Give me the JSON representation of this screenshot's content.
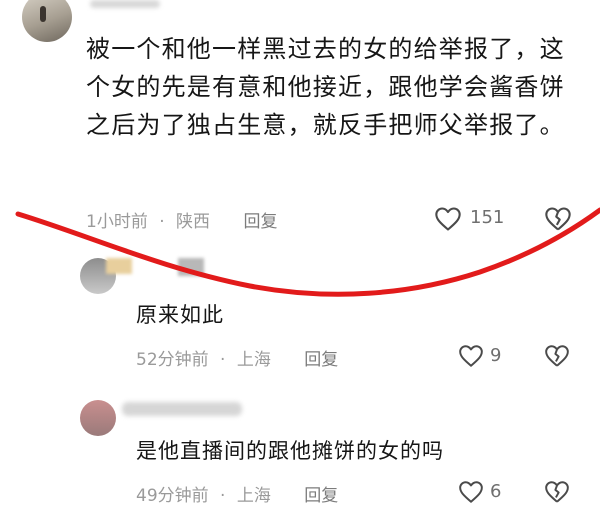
{
  "comments": [
    {
      "text": "被一个和他一样黑过去的女的给举报了，这个女的先是有意和他接近，跟他学会酱香饼之后为了独占生意，就反手把师父举报了。",
      "time": "1小时前",
      "dot": "·",
      "location": "陕西",
      "reply_label": "回复",
      "likes": "151"
    }
  ],
  "replies": [
    {
      "text": "原来如此",
      "time": "52分钟前",
      "dot": "·",
      "location": "上海",
      "reply_label": "回复",
      "likes": "9"
    },
    {
      "text": "是他直播间的跟他摊饼的女的吗",
      "time": "49分钟前",
      "dot": "·",
      "location": "上海",
      "reply_label": "回复",
      "likes": "6"
    }
  ],
  "colors": {
    "annotation_stroke": "#e21b1b",
    "meta_text": "#9a9a9a",
    "icon_stroke": "#4a4a4a"
  },
  "icons": [
    "heart-icon",
    "broken-heart-icon"
  ]
}
